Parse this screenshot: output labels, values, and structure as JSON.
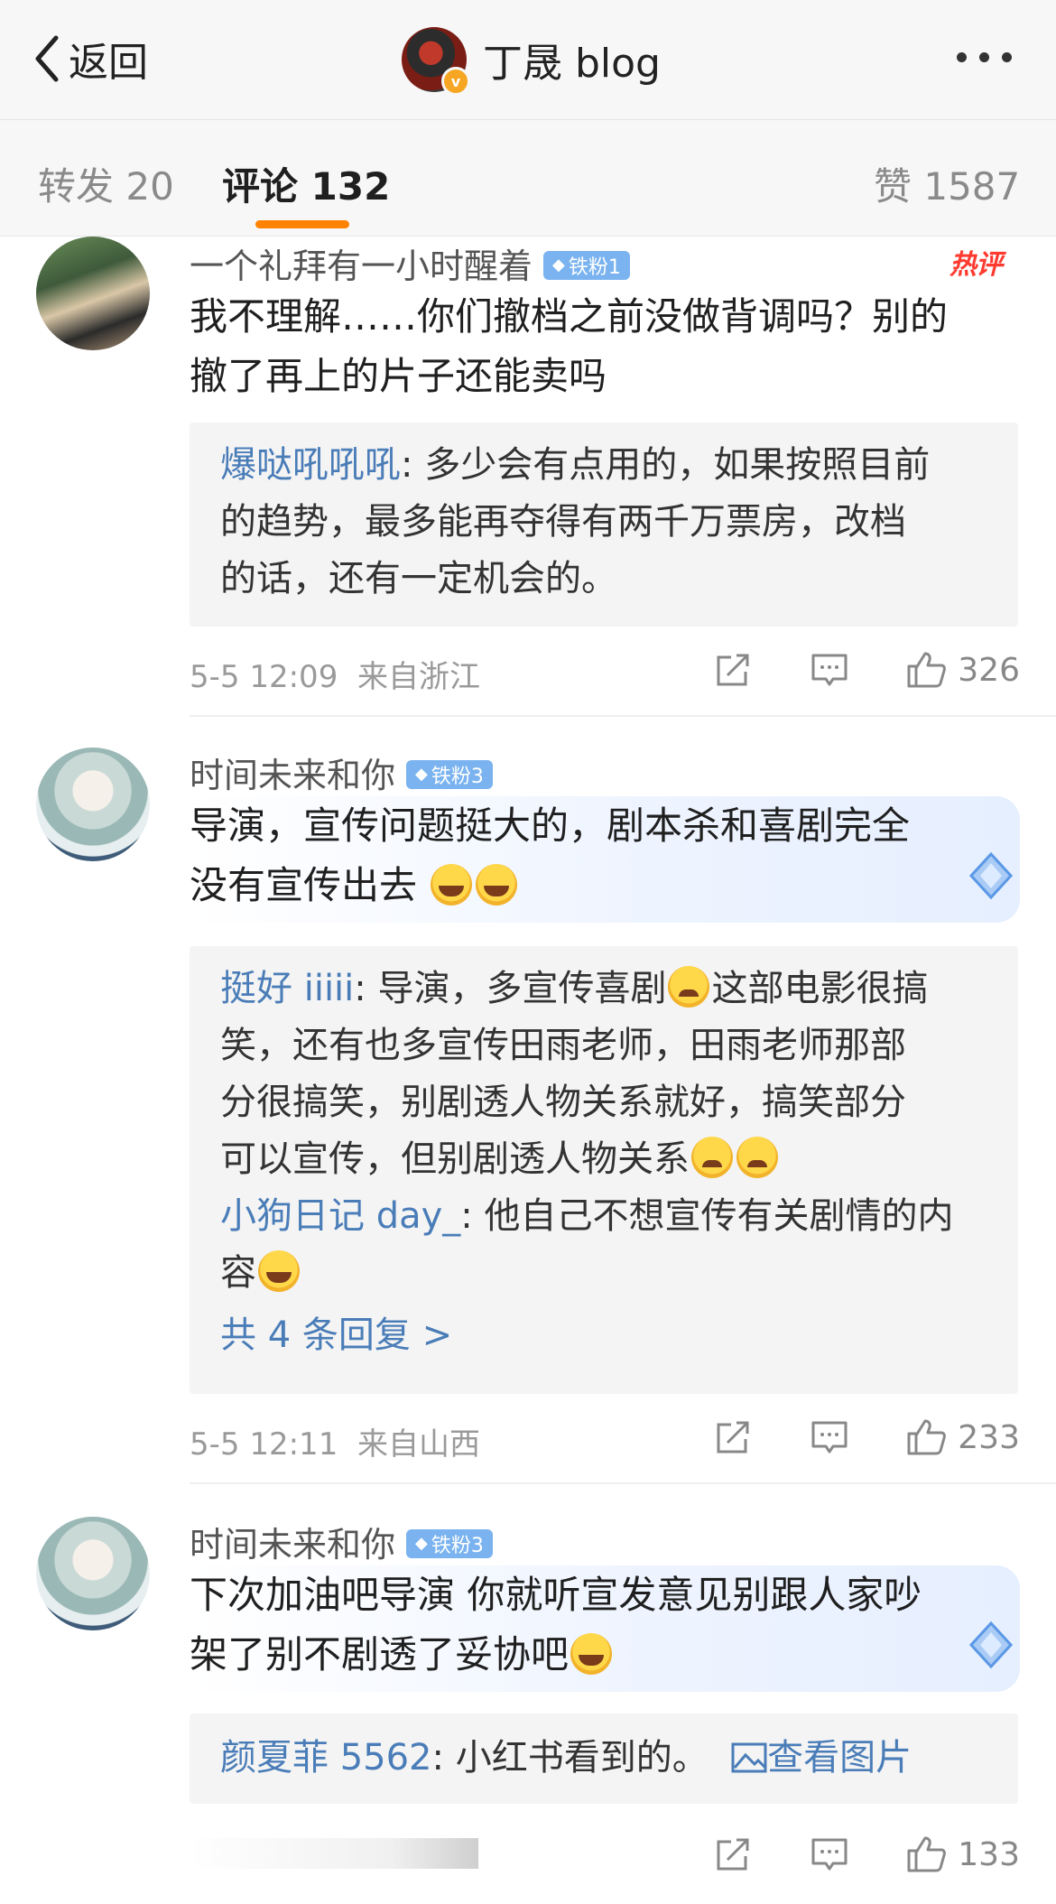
{
  "header": {
    "back_label": "返回",
    "title": "丁晟 blog",
    "verified_mark": "v"
  },
  "tabs": {
    "repost": "转发 20",
    "comments": "评论 132",
    "likes": "赞 1587"
  },
  "comments": [
    {
      "user": "一个礼拜有一小时醒着",
      "badge": "铁粉1",
      "hot_label": "热评",
      "text_lines": [
        "我不理解……你们撤档之前没做背调吗？别的",
        "撤了再上的片子还能卖吗"
      ],
      "replies": [
        {
          "name": "爆哒吼吼吼",
          "lines": [
            ": 多少会有点用的，如果按照目前",
            "的趋势，最多能再夺得有两千万票房，改档",
            "的话，还有一定机会的。"
          ]
        }
      ],
      "time": "5-5 12:09",
      "location": "来自浙江",
      "likes": "326"
    },
    {
      "user": "时间未来和你",
      "badge": "铁粉3",
      "text_lines": [
        "导演，宣传问题挺大的，剧本杀和喜剧完全",
        "没有宣传出去"
      ],
      "replies": [
        {
          "name": "挺好 iiiii",
          "lines": [
            ": 导演，多宣传喜剧",
            "这部电影很搞",
            "笑，还有也多宣传田雨老师，田雨老师那部",
            "分很搞笑，别剧透人物关系就好，搞笑部分",
            "可以宣传，但别剧透人物关系"
          ]
        },
        {
          "name": "小狗日记 day_",
          "lines": [
            ": 他自己不想宣传有关剧情的内",
            "容"
          ]
        }
      ],
      "more_replies": "共 4 条回复 >",
      "time": "5-5 12:11",
      "location": "来自山西",
      "likes": "233"
    },
    {
      "user": "时间未来和你",
      "badge": "铁粉3",
      "text_lines": [
        "下次加油吧导演 你就听宣发意见别跟人家吵",
        "架了别不剧透了妥协吧"
      ],
      "replies": [
        {
          "name": "颜夏菲 5562",
          "lines": [
            ": 小红书看到的。"
          ],
          "image_link": "查看图片"
        }
      ],
      "likes": "133"
    }
  ],
  "icons": [
    "chevron-left-icon",
    "more-dots-icon",
    "diamond-icon",
    "share-icon",
    "comment-icon",
    "thumbs-up-icon",
    "picture-icon",
    "laugh-cry-emoji",
    "crying-emoji"
  ]
}
